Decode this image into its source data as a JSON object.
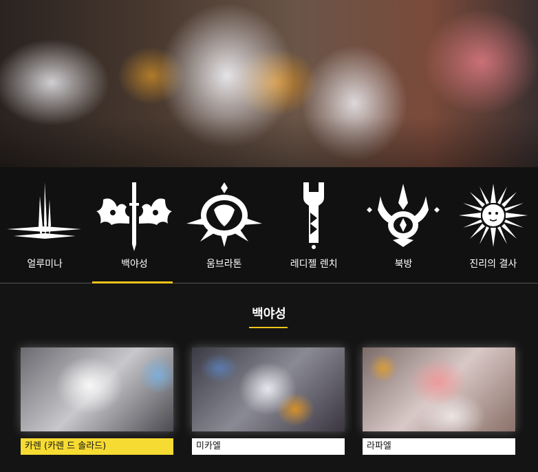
{
  "tabs": [
    {
      "label": "얼루미나",
      "icon": "alumina-cross-icon"
    },
    {
      "label": "백야성",
      "icon": "sword-emblem-icon"
    },
    {
      "label": "움브라톤",
      "icon": "umbraton-crest-icon"
    },
    {
      "label": "레디젤 렌치",
      "icon": "wrench-icon"
    },
    {
      "label": "북방",
      "icon": "north-crest-icon"
    },
    {
      "label": "진리의 결사",
      "icon": "sun-icon"
    }
  ],
  "active_tab_index": 1,
  "section": {
    "title": "백야성"
  },
  "cards": [
    {
      "name": "카렌 (카렌 드 솔라드)",
      "active": true
    },
    {
      "name": "미카엘",
      "active": false
    },
    {
      "name": "라파엘",
      "active": false
    }
  ],
  "colors": {
    "accent": "#f2c41b",
    "active_caption": "#f6db32",
    "background": "#141414"
  }
}
